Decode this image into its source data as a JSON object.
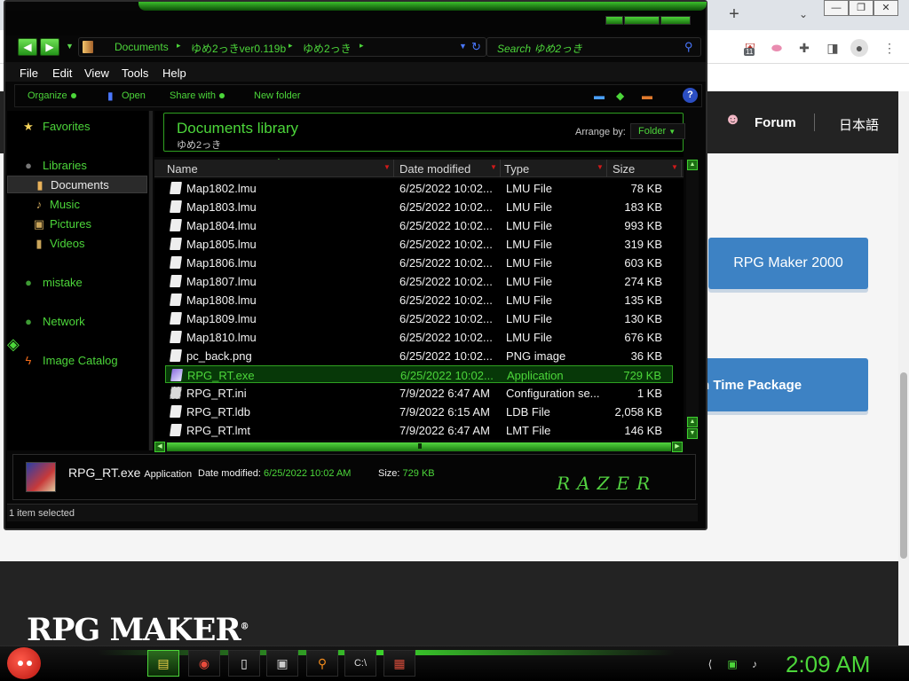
{
  "browser": {
    "new_tab": "+",
    "tab_list": "⌄",
    "window_controls": [
      "—",
      "❐",
      "✕"
    ],
    "ext_badge": "11",
    "more": "⋮"
  },
  "site": {
    "forum": "Forum",
    "language": "日本語",
    "rpgm2000_button": "RPG Maker 2000",
    "rtp_button": "n Time Package",
    "logo": "RPG MAKER",
    "logo_mark": "®"
  },
  "explorer": {
    "breadcrumb": [
      "Documents",
      "ゆめ2っきver0.119b",
      "ゆめ2っき"
    ],
    "search_placeholder": "Search ゆめ2っき",
    "menu": [
      "File",
      "Edit",
      "View",
      "Tools",
      "Help"
    ],
    "commands": {
      "organize": "Organize",
      "open": "Open",
      "share_with": "Share with",
      "new_folder": "New folder"
    },
    "help": "?",
    "nav_pane": {
      "favorites": "Favorites",
      "libraries": "Libraries",
      "documents": "Documents",
      "music": "Music",
      "pictures": "Pictures",
      "videos": "Videos",
      "homegroup": "mistake",
      "network": "Network",
      "image_catalog": "Image Catalog"
    },
    "library": {
      "title": "Documents library",
      "subtitle": "ゆめ2っき",
      "arrange_label": "Arrange by:",
      "arrange_value": "Folder"
    },
    "columns": [
      "Name",
      "Date modified",
      "Type",
      "Size"
    ],
    "files": [
      {
        "name": "Map1802.lmu",
        "date": "6/25/2022 10:02...",
        "type": "LMU File",
        "size": "78 KB"
      },
      {
        "name": "Map1803.lmu",
        "date": "6/25/2022 10:02...",
        "type": "LMU File",
        "size": "183 KB"
      },
      {
        "name": "Map1804.lmu",
        "date": "6/25/2022 10:02...",
        "type": "LMU File",
        "size": "993 KB"
      },
      {
        "name": "Map1805.lmu",
        "date": "6/25/2022 10:02...",
        "type": "LMU File",
        "size": "319 KB"
      },
      {
        "name": "Map1806.lmu",
        "date": "6/25/2022 10:02...",
        "type": "LMU File",
        "size": "603 KB"
      },
      {
        "name": "Map1807.lmu",
        "date": "6/25/2022 10:02...",
        "type": "LMU File",
        "size": "274 KB"
      },
      {
        "name": "Map1808.lmu",
        "date": "6/25/2022 10:02...",
        "type": "LMU File",
        "size": "135 KB"
      },
      {
        "name": "Map1809.lmu",
        "date": "6/25/2022 10:02...",
        "type": "LMU File",
        "size": "130 KB"
      },
      {
        "name": "Map1810.lmu",
        "date": "6/25/2022 10:02...",
        "type": "LMU File",
        "size": "676 KB"
      },
      {
        "name": "pc_back.png",
        "date": "6/25/2022 10:02...",
        "type": "PNG image",
        "size": "36 KB"
      },
      {
        "name": "RPG_RT.exe",
        "date": "6/25/2022 10:02...",
        "type": "Application",
        "size": "729 KB"
      },
      {
        "name": "RPG_RT.ini",
        "date": "7/9/2022 6:47 AM",
        "type": "Configuration se...",
        "size": "1 KB"
      },
      {
        "name": "RPG_RT.ldb",
        "date": "7/9/2022 6:15 AM",
        "type": "LDB File",
        "size": "2,058 KB"
      },
      {
        "name": "RPG_RT.lmt",
        "date": "7/9/2022 6:47 AM",
        "type": "LMT File",
        "size": "146 KB"
      }
    ],
    "details": {
      "name": "RPG_RT.exe",
      "type": "Application",
      "date_label": "Date modified:",
      "date": "6/25/2022 10:02 AM",
      "size_label": "Size:",
      "size": "729 KB",
      "brand": "RAZER"
    },
    "status": "1 item selected"
  },
  "taskbar": {
    "clock": "2:09 AM"
  },
  "colors": {
    "accent_green": "#4cd63a",
    "site_blue": "#3d82c4",
    "site_dark": "#232323"
  }
}
